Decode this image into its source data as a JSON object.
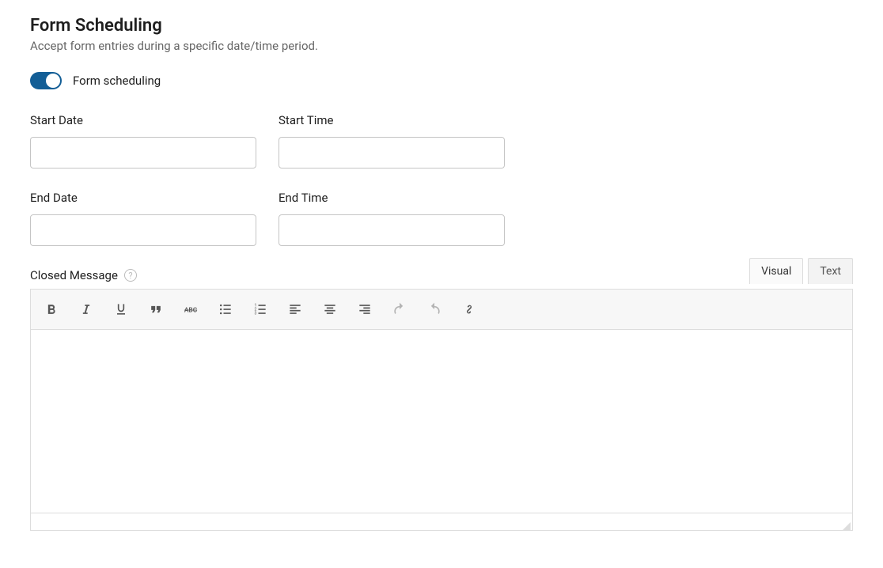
{
  "heading": "Form Scheduling",
  "subheading": "Accept form entries during a specific date/time period.",
  "toggle": {
    "label": "Form scheduling",
    "enabled": true
  },
  "fields": {
    "start_date": {
      "label": "Start Date",
      "value": ""
    },
    "start_time": {
      "label": "Start Time",
      "value": ""
    },
    "end_date": {
      "label": "End Date",
      "value": ""
    },
    "end_time": {
      "label": "End Time",
      "value": ""
    }
  },
  "closed_message": {
    "label": "Closed Message",
    "help_icon": "?"
  },
  "tabs": {
    "visual": "Visual",
    "text": "Text",
    "active": "visual"
  },
  "toolbar_icons": [
    "bold-icon",
    "italic-icon",
    "underline-icon",
    "quote-icon",
    "strike-icon",
    "bullet-list-icon",
    "number-list-icon",
    "align-left-icon",
    "align-center-icon",
    "align-right-icon",
    "undo-icon",
    "redo-icon",
    "link-icon"
  ],
  "editor": {
    "content": ""
  }
}
